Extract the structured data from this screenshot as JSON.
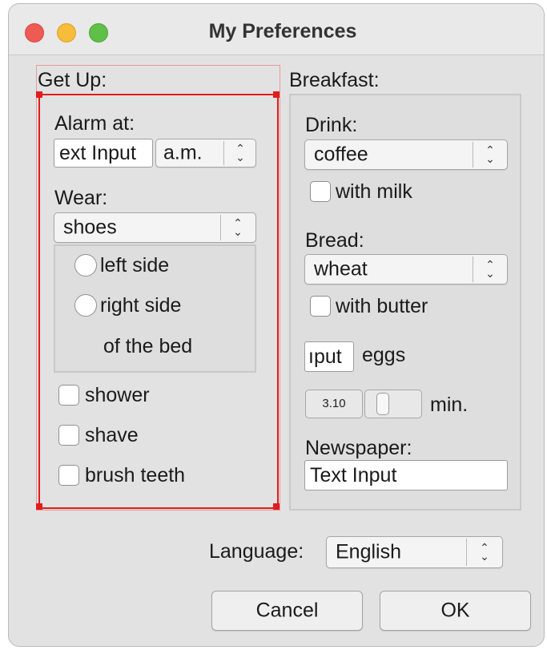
{
  "window": {
    "title": "My Preferences",
    "traffic_lights": {
      "close": "#ee5b55",
      "minimize": "#f6bc3b",
      "maximize": "#5ec048"
    }
  },
  "get_up": {
    "group_label": "Get Up:",
    "alarm_label": "Alarm at:",
    "alarm_time_value": "ext Input",
    "alarm_ampm": "a.m.",
    "wear_label": "Wear:",
    "wear_value": "shoes",
    "radio_left": "left side",
    "radio_right": "right side",
    "bed_label": "of the bed",
    "check_shower": "shower",
    "check_shave": "shave",
    "check_brush": "brush teeth",
    "selection_color": "#e01d1d"
  },
  "breakfast": {
    "group_label": "Breakfast:",
    "drink_label": "Drink:",
    "drink_value": "coffee",
    "check_milk": "with milk",
    "bread_label": "Bread:",
    "bread_value": "wheat",
    "check_butter": "with butter",
    "eggs_value": "ıput",
    "eggs_label": "eggs",
    "minutes_value": "3.10",
    "minutes_label": "min.",
    "newspaper_label": "Newspaper:",
    "newspaper_value": "Text Input"
  },
  "footer": {
    "language_label": "Language:",
    "language_value": "English",
    "cancel": "Cancel",
    "ok": "OK"
  }
}
